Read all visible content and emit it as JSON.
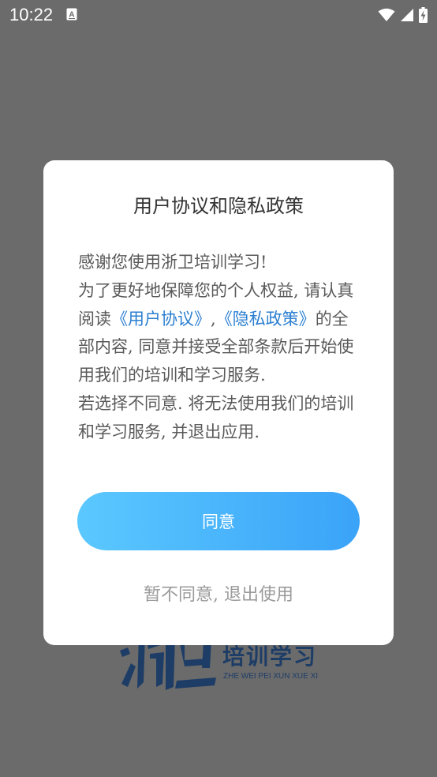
{
  "status_bar": {
    "time": "10:22",
    "icons": [
      "text-notification-icon",
      "wifi-icon",
      "cellular-signal-icon",
      "battery-charging-icon"
    ]
  },
  "background": {
    "logo_cn": "培训学习",
    "logo_en": "ZHE WEI PEI XUN XUE XI",
    "logo_color": "#1e3d66",
    "backdrop_color": "#6b6b6b"
  },
  "dialog": {
    "title": "用户协议和隐私政策",
    "body": {
      "greeting": "感谢您使用浙卫培训学习!",
      "intro_prefix": "为了更好地保障您的个人权益, 请认真阅读",
      "link_user_agreement": "《用户协议》",
      "separator": ",",
      "link_privacy_policy": "《隐私政策》",
      "intro_suffix": "的全部内容, 同意并接受全部条款后开始使用我们的培训和学习服务.",
      "decline_note": "若选择不同意. 将无法使用我们的培训和学习服务, 并退出应用."
    },
    "agree_label": "同意",
    "decline_label": "暂不同意, 退出使用",
    "colors": {
      "link": "#2b7fd1",
      "button_gradient_start": "#5bc8ff",
      "button_gradient_end": "#3aa3f8",
      "body_text": "#5a5a5a",
      "decline_text": "#9a9a9a"
    }
  }
}
